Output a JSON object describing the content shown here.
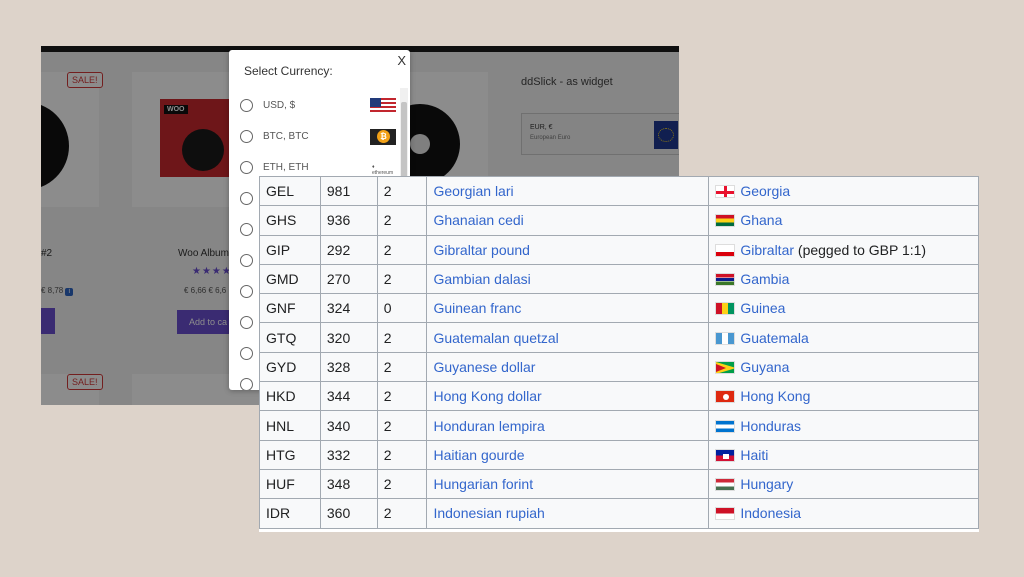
{
  "shop": {
    "widget_title": "ddSlick - as widget",
    "widget_currency": "EUR, €",
    "widget_currency_sub": "European Euro",
    "sale_badge": "SALE!",
    "products": [
      {
        "title": "#2",
        "price": "€ 8,78"
      },
      {
        "title": "Woo Album",
        "price": "€ 6,66 € 6,6",
        "stars": "★★★★",
        "cart_label": "Add to ca",
        "sleeve_tag": "WOO"
      }
    ]
  },
  "popup": {
    "title": "Select Currency:",
    "close_label": "X",
    "options": [
      {
        "label": "USD, $",
        "flag": "us-flag-icon"
      },
      {
        "label": "BTC, BTC",
        "flag": "bitcoin-icon"
      },
      {
        "label": "ETH, ETH",
        "flag": "ethereum-icon"
      },
      {
        "label": ""
      },
      {
        "label": ""
      },
      {
        "label": ""
      },
      {
        "label": ""
      },
      {
        "label": ""
      },
      {
        "label": ""
      },
      {
        "label": ""
      }
    ]
  },
  "table": {
    "rows": [
      {
        "code": "GEL",
        "num": "981",
        "digits": "2",
        "currency": "Georgian lari",
        "flag": "ge",
        "location": "Georgia",
        "note": ""
      },
      {
        "code": "GHS",
        "num": "936",
        "digits": "2",
        "currency": "Ghanaian cedi",
        "flag": "gh",
        "location": "Ghana",
        "note": ""
      },
      {
        "code": "GIP",
        "num": "292",
        "digits": "2",
        "currency": "Gibraltar pound",
        "flag": "gi",
        "location": "Gibraltar",
        "note": " (pegged to GBP 1:1)"
      },
      {
        "code": "GMD",
        "num": "270",
        "digits": "2",
        "currency": "Gambian dalasi",
        "flag": "gm",
        "location": "Gambia",
        "note": ""
      },
      {
        "code": "GNF",
        "num": "324",
        "digits": "0",
        "currency": "Guinean franc",
        "flag": "gn",
        "location": "Guinea",
        "note": ""
      },
      {
        "code": "GTQ",
        "num": "320",
        "digits": "2",
        "currency": "Guatemalan quetzal",
        "flag": "gt",
        "location": "Guatemala",
        "note": ""
      },
      {
        "code": "GYD",
        "num": "328",
        "digits": "2",
        "currency": "Guyanese dollar",
        "flag": "gy",
        "location": "Guyana",
        "note": ""
      },
      {
        "code": "HKD",
        "num": "344",
        "digits": "2",
        "currency": "Hong Kong dollar",
        "flag": "hk",
        "location": "Hong Kong",
        "note": ""
      },
      {
        "code": "HNL",
        "num": "340",
        "digits": "2",
        "currency": "Honduran lempira",
        "flag": "hn",
        "location": "Honduras",
        "note": ""
      },
      {
        "code": "HTG",
        "num": "332",
        "digits": "2",
        "currency": "Haitian gourde",
        "flag": "ht",
        "location": "Haiti",
        "note": ""
      },
      {
        "code": "HUF",
        "num": "348",
        "digits": "2",
        "currency": "Hungarian forint",
        "flag": "hu",
        "location": "Hungary",
        "note": ""
      },
      {
        "code": "IDR",
        "num": "360",
        "digits": "2",
        "currency": "Indonesian rupiah",
        "flag": "id",
        "location": "Indonesia",
        "note": ""
      }
    ]
  }
}
